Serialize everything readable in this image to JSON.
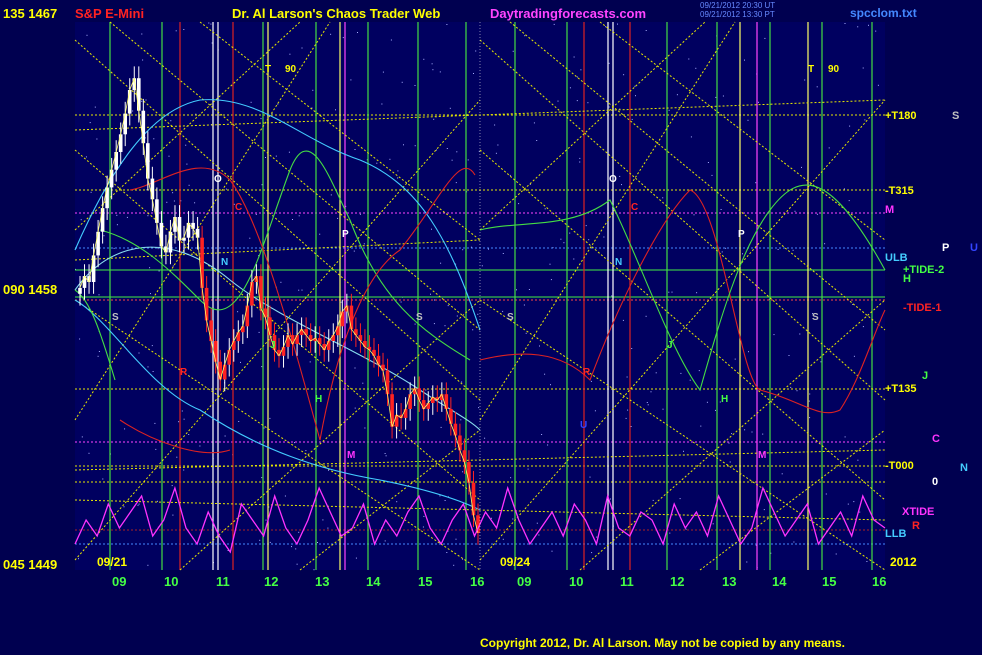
{
  "header": {
    "left_tag": "135 1467",
    "symbol": "S&P E-Mini",
    "title": "Dr. Al Larson's Chaos Trader Web",
    "site": "Daytradingforecasts.com",
    "timestamp_1": "09/21/2012 20:30 UT",
    "timestamp_2": "09/21/2012 13:30 PT",
    "file": "spcclom.txt"
  },
  "footer": {
    "copyright": "Copyright 2012, Dr. Al Larson. May not be copied by any means."
  },
  "colors": {
    "background": "#000050",
    "grid_yellow": "#e8e800",
    "green_line": "#44dd44",
    "red_line": "#dd2222",
    "white_line": "#ffffff",
    "magenta": "#ff33ff",
    "cyan": "#44ccff",
    "candle_up": "#ffffff",
    "candle_down": "#ff2222"
  },
  "chart_data": {
    "type": "line",
    "title": "S&P E-Mini",
    "y_axis": {
      "labels": [
        {
          "text": "135 1467",
          "value": 1467
        },
        {
          "text": "090 1458",
          "value": 1458
        },
        {
          "text": "045 1449",
          "value": 1449
        }
      ],
      "ylim": [
        1449,
        1467
      ]
    },
    "x_axis": {
      "date_labels": [
        "09/21",
        "09/24"
      ],
      "year_label": "2012",
      "hour_ticks": [
        "09",
        "10",
        "11",
        "12",
        "13",
        "14",
        "15",
        "16",
        "09",
        "10",
        "11",
        "12",
        "13",
        "14",
        "15",
        "16"
      ]
    },
    "right_labels": [
      {
        "text": "+T180",
        "color": "#ffff00"
      },
      {
        "text": "S",
        "color": "#c0c0c0"
      },
      {
        "text": "-T315",
        "color": "#ffff00"
      },
      {
        "text": "M",
        "color": "#ff33ff"
      },
      {
        "text": "ULB",
        "color": "#44ccff"
      },
      {
        "text": "P",
        "color": "#ffffff"
      },
      {
        "text": "U",
        "color": "#3344ff"
      },
      {
        "text": "+TIDE-2",
        "color": "#44ff44"
      },
      {
        "text": "H",
        "color": "#44ff44"
      },
      {
        "text": "-TIDE-1",
        "color": "#ff2222"
      },
      {
        "text": "J",
        "color": "#44ff44"
      },
      {
        "text": "+T135",
        "color": "#ffff00"
      },
      {
        "text": "C",
        "color": "#ff33ff"
      },
      {
        "text": "-T000",
        "color": "#ffff00"
      },
      {
        "text": "N",
        "color": "#44ccff"
      },
      {
        "text": "0",
        "color": "#ffffff"
      },
      {
        "text": "XTIDE",
        "color": "#ff33ff"
      },
      {
        "text": "R",
        "color": "#ff2222"
      },
      {
        "text": "LLB",
        "color": "#44ccff"
      }
    ],
    "planet_markers": [
      {
        "text": "T",
        "color": "#ffff00"
      },
      {
        "text": "90",
        "color": "#ffff00"
      },
      {
        "text": "O",
        "color": "#ffffff"
      },
      {
        "text": "C",
        "color": "#ff2222"
      },
      {
        "text": "P",
        "color": "#ffffff"
      },
      {
        "text": "N",
        "color": "#44ccff"
      },
      {
        "text": "S",
        "color": "#c0c0c0"
      },
      {
        "text": "R",
        "color": "#ff2222"
      },
      {
        "text": "J",
        "color": "#44ff44"
      },
      {
        "text": "H",
        "color": "#44ff44"
      },
      {
        "text": "M",
        "color": "#ff33ff"
      },
      {
        "text": "U",
        "color": "#3344ff"
      }
    ],
    "price_series": {
      "name": "S&P E-Mini",
      "close": [
        1458.2,
        1458.6,
        1458.4,
        1459.3,
        1460.1,
        1460.9,
        1461.6,
        1462.2,
        1462.8,
        1463.4,
        1464.1,
        1464.9,
        1465.3,
        1464.2,
        1463.1,
        1461.9,
        1461.2,
        1460.4,
        1459.6,
        1459.4,
        1460.1,
        1460.6,
        1459.8,
        1459.9,
        1460.4,
        1460.2,
        1459.9,
        1458.2,
        1457.1,
        1456.4,
        1455.7,
        1455.1,
        1455.6,
        1456.1,
        1456.4,
        1456.7,
        1456.9,
        1457.6,
        1458.4,
        1458.6,
        1457.5,
        1457.2,
        1456.6,
        1456.1,
        1455.9,
        1456.2,
        1456.6,
        1456.3,
        1456.6,
        1456.8,
        1456.6,
        1456.4,
        1456.5,
        1456.3,
        1456.1,
        1456.4,
        1456.6,
        1456.9,
        1457.4,
        1457.6,
        1456.8,
        1456.6,
        1456.4,
        1456.2,
        1456.1,
        1455.9,
        1455.6,
        1455.4,
        1454.6,
        1453.5,
        1453.9,
        1453.8,
        1454.1,
        1454.6,
        1454.8,
        1454.4,
        1454.1,
        1454.3,
        1454.5,
        1454.4,
        1454.6,
        1454.1,
        1453.6,
        1453.2,
        1452.7,
        1452.3,
        1451.6,
        1450.5,
        1449.9
      ]
    },
    "series": [
      {
        "name": "XTIDE",
        "color": "#ff33ff",
        "values": [
          0.2,
          0.5,
          0.3,
          0.7,
          0.4,
          0.6,
          0.8,
          0.3,
          0.5,
          0.9,
          0.4,
          0.2,
          0.6,
          0.3,
          0.1,
          0.7,
          0.5,
          0.3,
          0.8,
          0.4,
          0.2,
          0.5,
          0.9,
          0.6,
          0.3,
          0.4,
          0.7,
          0.2,
          0.5,
          0.3,
          0.6,
          0.8,
          0.4,
          0.2,
          0.5,
          0.7,
          0.3,
          0.6,
          0.4,
          0.9,
          0.5,
          0.2,
          0.4,
          0.6,
          0.3,
          0.7,
          0.5,
          0.2,
          0.8,
          0.4,
          0.3,
          0.6,
          0.5,
          0.2,
          0.7,
          0.4,
          0.6,
          0.3,
          0.8,
          0.5,
          0.2,
          0.4,
          0.9,
          0.6,
          0.3,
          0.5,
          0.7,
          0.2,
          0.4,
          0.6,
          0.3,
          0.8,
          0.5,
          0.4
        ]
      }
    ]
  }
}
